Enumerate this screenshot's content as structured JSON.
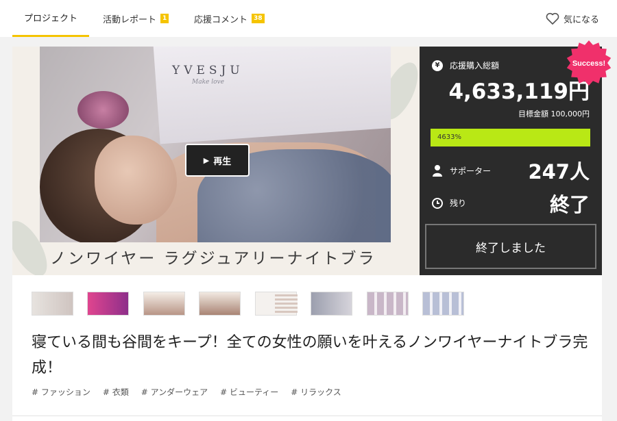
{
  "nav": {
    "tabs": [
      {
        "label": "プロジェクト",
        "badge": ""
      },
      {
        "label": "活動レポート",
        "badge": "1"
      },
      {
        "label": "応援コメント",
        "badge": "38"
      }
    ],
    "favorite_label": "気になる"
  },
  "hero": {
    "brand": "YVESJU",
    "brand_sub": "Make love",
    "play_label": "再生",
    "caption": "ノンワイヤー ラグジュアリーナイトブラ"
  },
  "stats": {
    "total_label": "応援購入総額",
    "total_amount": "4,633,119円",
    "goal_text": "目標金額 100,000円",
    "progress_label": "4633%",
    "progress_fraction": 1.0,
    "supporters_label": "サポーター",
    "supporters_value": "247人",
    "remaining_label": "残り",
    "remaining_value": "終了",
    "end_button": "終了しました",
    "badge": "Success!"
  },
  "project": {
    "title": "寝ている間も谷間をキープ！全ての女性の願いを叶えるノンワイヤーナイトブラ完成！",
    "tags": [
      "# ファッション",
      "# 衣類",
      "# アンダーウェア",
      "# ビューティー",
      "# リラックス"
    ]
  },
  "colors": {
    "accent": "#f5c400",
    "progress": "#b9e815",
    "panel": "#2b2b2b",
    "success": "#f0306b"
  }
}
